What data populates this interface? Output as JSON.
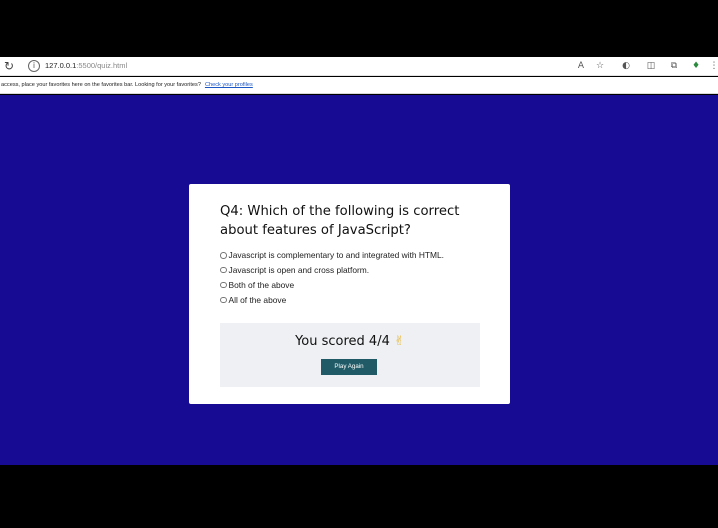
{
  "browser": {
    "url_host": "127.0.0.1",
    "url_rest": ":5500/quiz.html",
    "favorites_message": "access, place your favorites here on the favorites bar. Looking for your favorites?",
    "favorites_link": "Check your profiles"
  },
  "quiz": {
    "question": "Q4: Which of the following is correct about features of JavaScript?",
    "options": [
      "Javascript is complementary to and integrated with HTML.",
      "Javascript is open and cross platform.",
      "Both of the above",
      "All of the above"
    ],
    "score_text": "You scored 4/4",
    "score_emoji": "✌",
    "play_again_label": "Play Again"
  }
}
